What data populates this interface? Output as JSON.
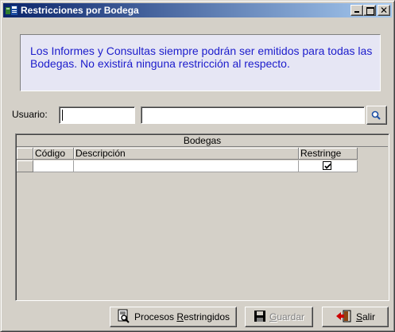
{
  "window": {
    "title": "Restricciones por Bodega",
    "close_glyph": "✕",
    "icon": "warehouse-app-icon"
  },
  "info": {
    "message": "Los Informes y Consultas siempre podrán ser emitidos para todas las Bodegas.  No existirá ninguna restricción al respecto."
  },
  "user": {
    "label": "Usuario:",
    "code_value": "",
    "description_value": "",
    "search_icon": "search-icon"
  },
  "grid": {
    "caption": "Bodegas",
    "columns": [
      "Código",
      "Descripción",
      "Restringe"
    ],
    "rows": [
      {
        "codigo": "",
        "descripcion": "",
        "restringe": true
      }
    ]
  },
  "buttons": {
    "procesos": {
      "prefix": "Procesos ",
      "accel": "R",
      "rest": "estringidos"
    },
    "guardar": {
      "accel": "G",
      "rest": "uardar",
      "enabled": false
    },
    "salir": {
      "accel": "S",
      "rest": "alir"
    }
  }
}
